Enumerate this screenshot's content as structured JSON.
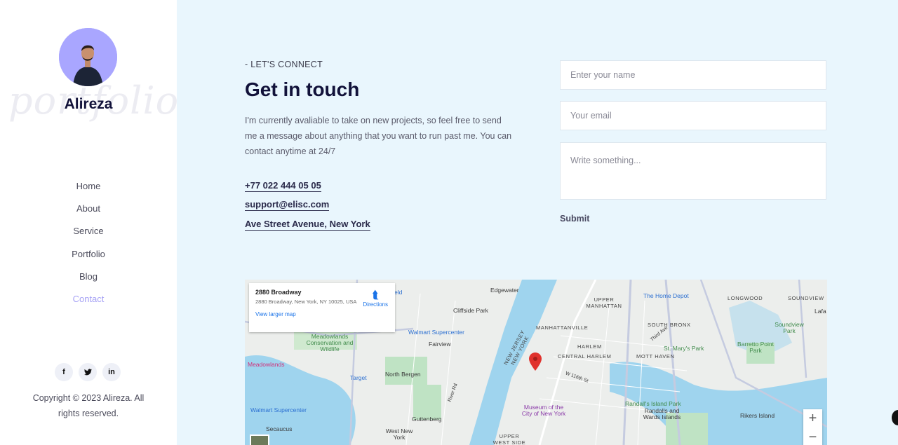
{
  "sidebar": {
    "watermark": "portfolio",
    "name": "Alireza",
    "nav": [
      "Home",
      "About",
      "Service",
      "Portfolio",
      "Blog",
      "Contact"
    ],
    "active_nav": "Contact",
    "socials": [
      "f",
      "t",
      "in"
    ],
    "copyright": "Copyright © 2023 Alireza. All rights reserved."
  },
  "contact": {
    "eyebrow": "- LET'S CONNECT",
    "title": "Get in touch",
    "description": "I'm currently avaliable to take on new projects, so feel free to send me a message about anything that you want to run past me. You can contact anytime at 24/7",
    "phone": "+77 022 444 05 05",
    "email": "support@elisc.com",
    "address": "Ave Street Avenue, New York"
  },
  "form": {
    "name_placeholder": "Enter your name",
    "email_placeholder": "Your email",
    "message_placeholder": "Write something...",
    "submit_label": "Submit"
  },
  "map": {
    "card_title": "2880 Broadway",
    "card_address": "2880 Broadway, New York, NY 10025, USA",
    "card_larger": "View larger map",
    "card_directions": "Directions",
    "zoom_in": "+",
    "zoom_out": "−",
    "labels": {
      "edgewater": "Edgewater",
      "cliffside": "Cliffside Park",
      "fairview": "Fairview",
      "walmart1": "Walmart Supercenter",
      "walmart2": "Walmart Supercenter",
      "meadowlands_cons": "Meadowlands Conservation and Wildlife",
      "meadowlands": "Meadowlands",
      "north_bergen": "North Bergen",
      "target": "Target",
      "secaucus": "Secaucus",
      "guttenberg": "Guttenberg",
      "west_new_york": "West New York",
      "upper_manhattan": "UPPER MANHATTAN",
      "manhattanville": "MANHATTANVILLE",
      "harlem": "HARLEM",
      "central_harlem": "CENTRAL HARLEM",
      "upper_west_side": "UPPER WEST SIDE",
      "home_depot": "The Home Depot",
      "south_bronx": "SOUTH BRONX",
      "mott_haven": "MOTT HAVEN",
      "longwood": "LONGWOOD",
      "soundview": "SOUNDVIEW",
      "soundview_park": "Soundview Park",
      "st_marys": "St. Mary's Park",
      "barretto": "Barretto Point Park",
      "museum": "Museum of the City of New York",
      "randalls": "Randall's Island Park",
      "randalls_wards": "Randalls and Wards Islands",
      "rikers": "Rikers Island",
      "nj_ny": "NEW JERSEY NEW YORK",
      "w116": "W 116th St",
      "third_ave": "Third Ave",
      "river_rd": "River Rd",
      "fld": "eld",
      "lafa": "Lafa"
    }
  }
}
